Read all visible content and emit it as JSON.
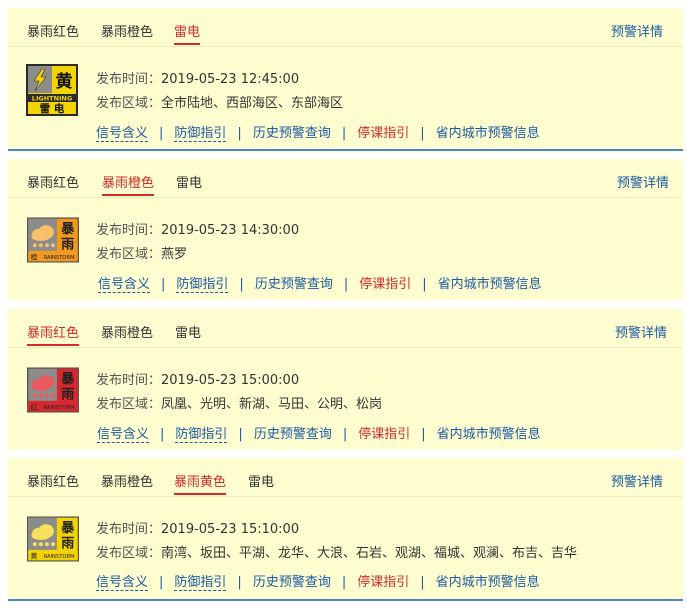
{
  "common": {
    "details": "预警详情",
    "time_label": "发布时间：",
    "area_label": "发布区域：",
    "links": [
      "信号含义",
      "防御指引",
      "历史预警查询",
      "停课指引",
      "省内城市预警信息"
    ]
  },
  "colors": {
    "panel_bg": "#fefdd0",
    "active_tab": "#d22b2b",
    "link": "#1c5aa3",
    "panel_border": "#4a86c5"
  },
  "panel1": {
    "tabs": [
      "暴雨红色",
      "暴雨橙色",
      "雷电"
    ],
    "active_tab": 2,
    "icon": "thunder-yellow-icon",
    "icon_text": {
      "level": "黄",
      "en": "LIGHTNING",
      "name": "雷 电"
    },
    "time": "2019-05-23 12:45:00",
    "area": "全市陆地、西部海区、东部海区"
  },
  "panel2": {
    "tabs": [
      "暴雨红色",
      "暴雨橙色",
      "雷电"
    ],
    "active_tab": 1,
    "icon": "rainstorm-orange-icon",
    "icon_text": {
      "c1": "暴",
      "c2": "雨",
      "level": "橙",
      "en": "RAINSTORM"
    },
    "time": "2019-05-23 14:30:00",
    "area": "燕罗"
  },
  "panel3": {
    "tabs": [
      "暴雨红色",
      "暴雨橙色",
      "雷电"
    ],
    "active_tab": 0,
    "icon": "rainstorm-red-icon",
    "icon_text": {
      "c1": "暴",
      "c2": "雨",
      "level": "红",
      "en": "RAINSTORM"
    },
    "time": "2019-05-23 15:00:00",
    "area": "凤凰、光明、新湖、马田、公明、松岗"
  },
  "panel4": {
    "tabs": [
      "暴雨红色",
      "暴雨橙色",
      "暴雨黄色",
      "雷电"
    ],
    "active_tab": 2,
    "icon": "rainstorm-yellow-icon",
    "icon_text": {
      "c1": "暴",
      "c2": "雨",
      "level": "黄",
      "en": "RAINSTORM"
    },
    "time": "2019-05-23 15:10:00",
    "area": "南湾、坂田、平湖、龙华、大浪、石岩、观湖、福城、观澜、布吉、吉华"
  }
}
